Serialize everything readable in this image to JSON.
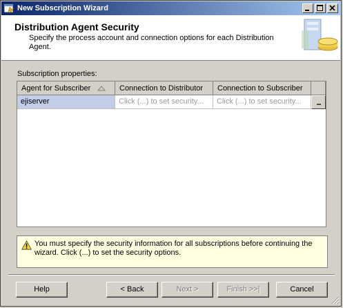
{
  "window": {
    "title": "New Subscription Wizard"
  },
  "header": {
    "title": "Distribution Agent Security",
    "description": "Specify the process account and connection options for each Distribution Agent."
  },
  "subscription_properties_label": "Subscription properties:",
  "grid": {
    "columns": [
      "Agent for Subscriber",
      "Connection to Distributor",
      "Connection to Subscriber"
    ],
    "rows": [
      {
        "agent": "ejiserver",
        "distributor": "Click (...) to set security...",
        "subscriber": "Click (...) to set security..."
      }
    ],
    "ellipsis": "..."
  },
  "warning": {
    "text": "You must specify the security information for all subscriptions before continuing the wizard. Click (...) to set the security options."
  },
  "buttons": {
    "help": "Help",
    "back": "< Back",
    "next": "Next >",
    "finish": "Finish >>|",
    "cancel": "Cancel"
  }
}
